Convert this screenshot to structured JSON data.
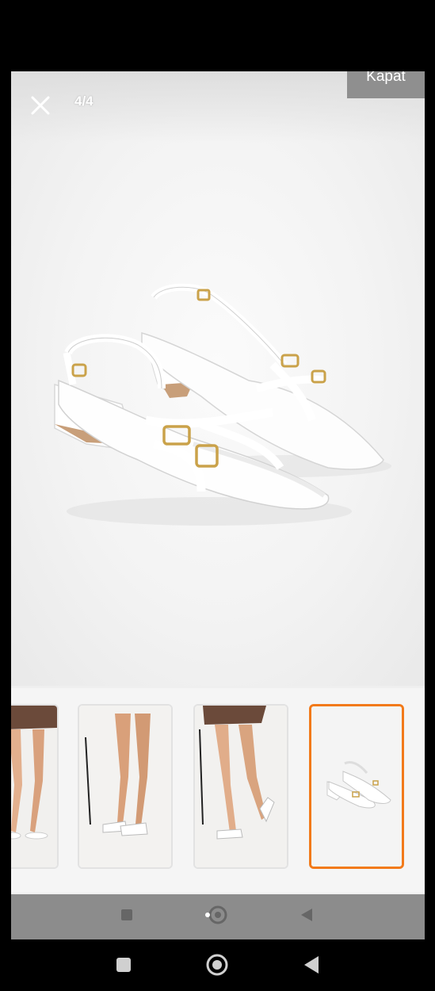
{
  "viewer": {
    "counter": "4/4",
    "close_label": "Kapat",
    "close_icon": "close-icon"
  },
  "thumbnails": [
    {
      "id": 1,
      "name": "thumbnail-legs-dress-1",
      "selected": false
    },
    {
      "id": 2,
      "name": "thumbnail-legs-2",
      "selected": false
    },
    {
      "id": 3,
      "name": "thumbnail-legs-dress-3",
      "selected": false
    },
    {
      "id": 4,
      "name": "thumbnail-shoes-4",
      "selected": true
    }
  ],
  "colors": {
    "accent": "#f27a1a",
    "kapat_bg": "#8f8f8f"
  },
  "system_nav": {
    "icons": [
      "recents-icon",
      "home-icon",
      "back-icon"
    ]
  }
}
